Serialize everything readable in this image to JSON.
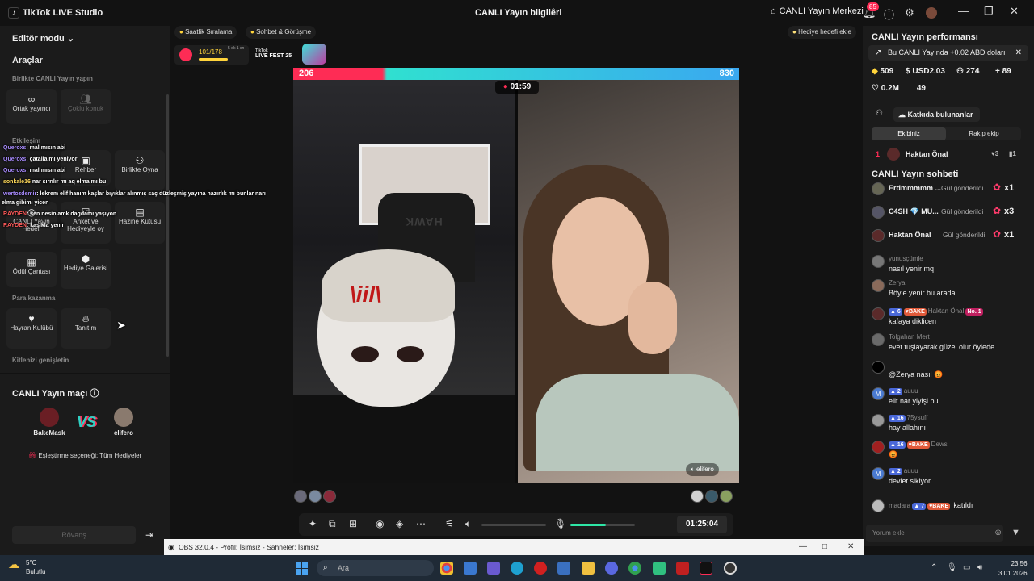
{
  "titlebar": {
    "app_title": "TikTok LIVE Studio",
    "live_info": "CANLI Yayın bilgileri",
    "live_center": "CANLI Yayın Merkezi",
    "notification_count": "85"
  },
  "left": {
    "editor_mode": "Editör modu",
    "tools_title": "Araçlar",
    "collab_title": "Birlikte CANLI Yayın yapın",
    "co_host": "Ortak yayıncı",
    "multi_guest": "Çoklu konuk",
    "interaction_title": "Etkileşim",
    "guide": "Rehber",
    "play_together": "Birlikte Oyna",
    "live_gift": "CANLI Yayın Hedefi",
    "poll": "Anket ve Hediyeyle oy",
    "treasure": "Hazine Kutusu",
    "reward_bag": "Ödül Çantası",
    "gift_gallery": "Hediye Galerisi",
    "monetize_title": "Para kazanma",
    "fan_club": "Hayran Kulübü",
    "promote": "Tanıtım",
    "expand_title": "Kitlenizi genişletin"
  },
  "overlay_chat": [
    {
      "user": "Queroxs",
      "text": ": mal mısın abi"
    },
    {
      "user": "Queroxs",
      "text": ": çatalla mı yeniyor"
    },
    {
      "user": "Queroxs",
      "text": ": mal mısın abi"
    },
    {
      "user": "sonkale16",
      "text": "nar sırrılır mı aq elma mı bu"
    },
    {
      "user": "wertozdemir",
      "text": ": lekrem elif hanım kaşlar bıyıklar alınmış saç düzleşmiş yayına hazırlık mı bunlar narı"
    },
    {
      "user": "",
      "text": "elma gibimi yicen"
    },
    {
      "user": "RAYDEN",
      "text": ": sen nesin amk dagdamı yaşıyon"
    },
    {
      "user": "RAYDEN",
      "text": ": kaşıkla yenir"
    }
  ],
  "match": {
    "title": "CANLI Yayın maçı",
    "player1": "BakeMask",
    "player2": "elifero",
    "vs": "VS",
    "option": "Eşleştirme seçeneği: Tüm Hediyeler",
    "rematch": "Rövanş"
  },
  "stage": {
    "chip_hourly": "Saatlik Sıralama",
    "chip_chat": "Sohbet & Görüşme",
    "gift_goal_add": "Hediye hedefi ekle",
    "goal_count": "101/178",
    "goal_time": "5 dk 1 sn",
    "livefest_top": "TikTok",
    "livefest": "LIVE FEST 25",
    "score_left": "206",
    "score_right": "830",
    "timer": "01:59",
    "guest_name": "elifero",
    "elapsed": "01:25:04",
    "mask_text": "HAWK"
  },
  "right": {
    "perf_title": "CANLI Yayın performansı",
    "perf_banner": "Bu CANLI Yayında +0.02 ABD doları",
    "stat_coins": "509",
    "stat_usd": "USD2.03",
    "stat_viewers": "274",
    "stat_new": "89",
    "stat_likes": "0.2M",
    "stat_gifts": "49",
    "contributors": "Katkıda bulunanlar",
    "tab_our": "Ekibiniz",
    "tab_rival": "Rakip ekip",
    "rank_num": "1",
    "rank_name": "Haktan Önal",
    "rank_stat1": "3",
    "rank_stat2": "1",
    "chat_title": "CANLI Yayın sohbeti",
    "gifts": [
      {
        "name": "Erdmmmmm ...",
        "msg": "Gül gönderildi",
        "count": "x1"
      },
      {
        "name": "C4SH 💎 MU...",
        "msg": "Gül gönderildi",
        "count": "x3"
      },
      {
        "name": "Haktan Önal",
        "msg": "Gül gönderildi",
        "count": "x1"
      }
    ],
    "messages": [
      {
        "name": "yunusçümle",
        "text": "nasıl yenir mq"
      },
      {
        "name": "Zerya",
        "text": "Böyle yenir bu arada"
      },
      {
        "name": "Haktan Önal",
        "text": "kafaya diklicen",
        "lvl": "6",
        "fan": "BAKE",
        "rank": "No. 1"
      },
      {
        "name": "Tolgahan Mert",
        "text": "evet tuşlayarak güzel olur öylede"
      },
      {
        "name": ".",
        "text": "@Zerya nasıl 😡"
      },
      {
        "name": "auuu",
        "text": "elit nar yiyişi bu",
        "lvl": "2"
      },
      {
        "name": "75ysuff",
        "text": "hay allahını",
        "lvl": "16"
      },
      {
        "name": "Dews",
        "text": "😡",
        "lvl": "16",
        "fan": "BAKE"
      },
      {
        "name": "auuu",
        "text": "devlet sikiyor",
        "lvl": "2"
      },
      {
        "name": "madara",
        "text": "katıldı",
        "lvl": "7",
        "fan": "BAKE"
      }
    ],
    "comment_placeholder": "Yorum ekle"
  },
  "obs": {
    "title": "OBS 32.0.4 - Profil: İsimsiz - Sahneler: İsimsiz"
  },
  "taskbar": {
    "temp": "5°C",
    "weather": "Bulutlu",
    "search": "Ara",
    "time": "23:56",
    "date": "3.01.2026"
  },
  "colors": {
    "accent_pink": "#fe2c55",
    "accent_cyan": "#2fd1c4",
    "volume_green": "#2ee6a6"
  }
}
